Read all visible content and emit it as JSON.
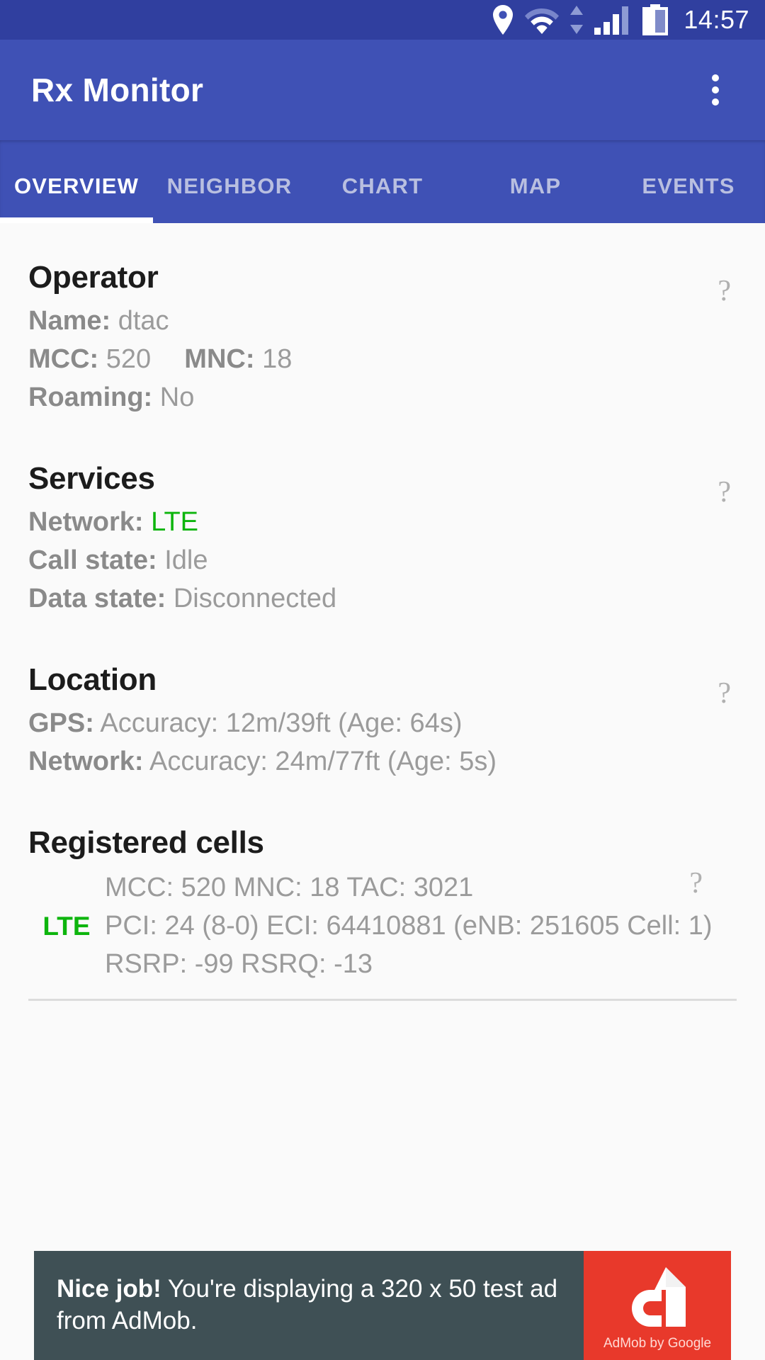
{
  "status_bar": {
    "time": "14:57",
    "icons": [
      "location-pin-icon",
      "wifi-icon",
      "data-transfer-icon",
      "signal-bars-icon",
      "battery-icon"
    ]
  },
  "app_bar": {
    "title": "Rx Monitor",
    "overflow_menu": "overflow-menu-icon"
  },
  "tabs": [
    {
      "label": "OVERVIEW",
      "active": true
    },
    {
      "label": "NEIGHBOR",
      "active": false
    },
    {
      "label": "CHART",
      "active": false
    },
    {
      "label": "MAP",
      "active": false
    },
    {
      "label": "EVENTS",
      "active": false
    }
  ],
  "help_icon": "?",
  "operator": {
    "title": "Operator",
    "name_label": "Name:",
    "name_value": "dtac",
    "mcc_label": "MCC:",
    "mcc_value": "520",
    "mnc_label": "MNC:",
    "mnc_value": "18",
    "roaming_label": "Roaming:",
    "roaming_value": "No"
  },
  "services": {
    "title": "Services",
    "network_label": "Network:",
    "network_value": "LTE",
    "call_state_label": "Call state:",
    "call_state_value": "Idle",
    "data_state_label": "Data state:",
    "data_state_value": "Disconnected"
  },
  "location": {
    "title": "Location",
    "gps_label": "GPS:",
    "gps_value": "Accuracy: 12m/39ft (Age: 64s)",
    "network_label": "Network:",
    "network_value": "Accuracy: 24m/77ft (Age: 5s)"
  },
  "registered_cells": {
    "title": "Registered cells",
    "badge": "LTE",
    "line1": "MCC: 520  MNC: 18  TAC: 3021",
    "line2": "PCI: 24 (8-0)  ECI: 64410881 (eNB: 251605 Cell: 1)",
    "line3": "RSRP: -99  RSRQ: -13"
  },
  "ad": {
    "headline": "Nice job!",
    "body": " You're displaying a 320 x 50 test ad from AdMob.",
    "logo_caption": "AdMob by Google",
    "brand_color": "#e8392b"
  },
  "colors": {
    "status_bar": "#303f9f",
    "app_bar": "#3f51b5",
    "accent_green": "#0db50d",
    "background": "#fafafa"
  }
}
